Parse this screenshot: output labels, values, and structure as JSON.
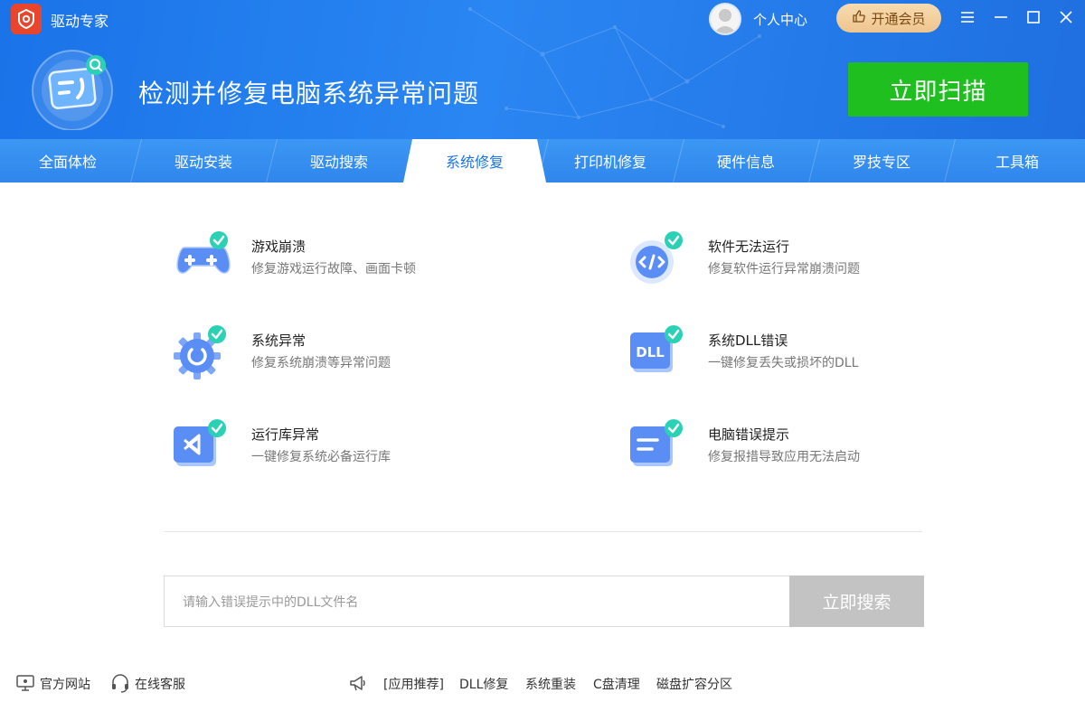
{
  "app": {
    "title": "驱动专家"
  },
  "header": {
    "user_center": "个人中心",
    "vip_label": "开通会员",
    "hero_title": "检测并修复电脑系统异常问题",
    "scan_button": "立即扫描",
    "icons": {
      "logo": "gear-shield-icon",
      "menu": "hamburger-icon",
      "min": "minimize-icon",
      "max": "maximize-icon",
      "close": "close-icon"
    }
  },
  "tabs": [
    {
      "label": "全面体检"
    },
    {
      "label": "驱动安装"
    },
    {
      "label": "驱动搜索"
    },
    {
      "label": "系统修复"
    },
    {
      "label": "打印机修复"
    },
    {
      "label": "硬件信息"
    },
    {
      "label": "罗技专区"
    },
    {
      "label": "工具箱"
    }
  ],
  "active_tab": "系统修复",
  "items": [
    {
      "title": "游戏崩溃",
      "desc": "修复游戏运行故障、画面卡顿",
      "icon": "gamepad-icon"
    },
    {
      "title": "软件无法运行",
      "desc": "修复软件运行异常崩溃问题",
      "icon": "code-icon"
    },
    {
      "title": "系统异常",
      "desc": "修复系统崩溃等异常问题",
      "icon": "gear-icon"
    },
    {
      "title": "系统DLL错误",
      "desc": "一键修复丢失或损坏的DLL",
      "icon": "dll-icon"
    },
    {
      "title": "运行库异常",
      "desc": "一键修复系统必备运行库",
      "icon": "visual-studio-icon"
    },
    {
      "title": "电脑错误提示",
      "desc": "修复报措导致应用无法启动",
      "icon": "message-icon"
    }
  ],
  "search": {
    "placeholder": "请输入错误提示中的DLL文件名",
    "button": "立即搜索"
  },
  "footer": {
    "official_site": "官方网站",
    "online_service": "在线客服",
    "recommend": "[应用推荐]",
    "links": [
      "DLL修复",
      "系统重装",
      "C盘清理",
      "磁盘扩容分区"
    ]
  },
  "colors": {
    "brand_blue": "#1a73e8",
    "scan_green": "#1fbf1f",
    "check_teal": "#2ad1b5",
    "vip_gold": "#eec58e"
  }
}
